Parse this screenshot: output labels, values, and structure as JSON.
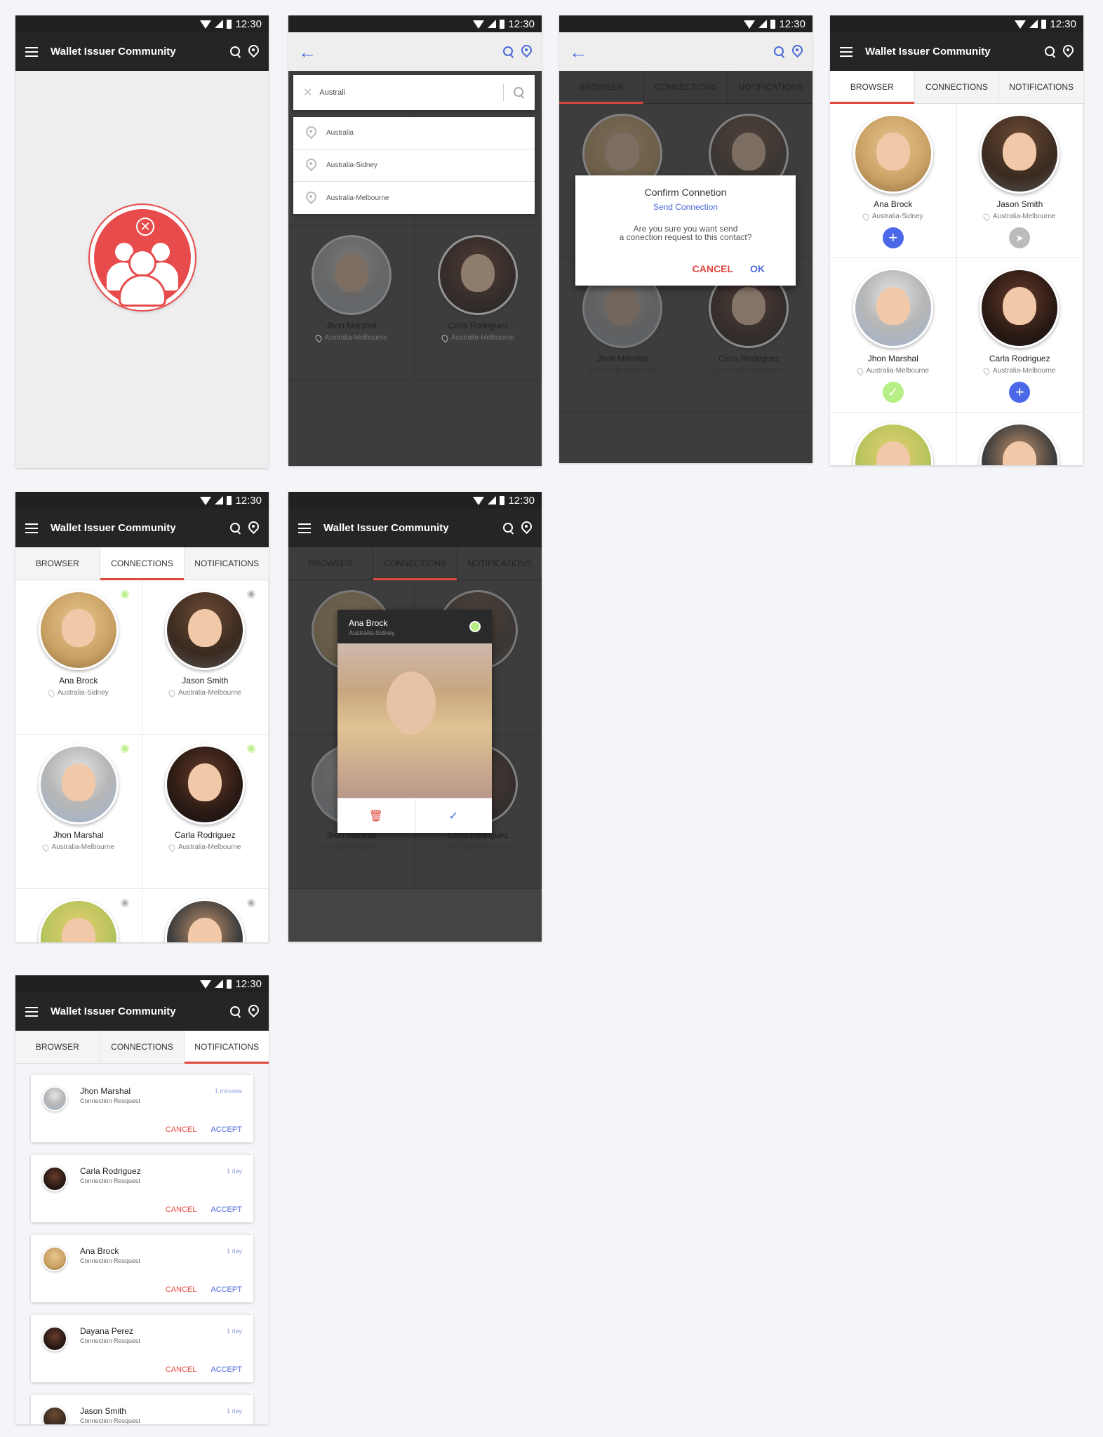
{
  "status": {
    "time": "12:30"
  },
  "app": {
    "title": "Wallet Issuer Community"
  },
  "tabs": {
    "browser": "BROWSER",
    "connections": "CONNECTIONS",
    "notifications": "NOTIFICATIONS"
  },
  "search": {
    "query": "Australi",
    "suggestions": [
      "Australia",
      "Australia-Sidney",
      "Australia-Melbourne"
    ]
  },
  "contacts": [
    {
      "name": "Ana Brock",
      "location": "Australia-Sidney"
    },
    {
      "name": "Jason Smith",
      "location": "Australia-Melbourne"
    },
    {
      "name": "Jhon Marshal",
      "location": "Australia-Melbourne"
    },
    {
      "name": "Carla Rodriguez",
      "location": "Australia-Melbourne"
    }
  ],
  "dialog": {
    "title": "Confirm Connetion",
    "subtitle": "Send Connection",
    "line1": "Are you sure you want send",
    "line2": "a conection request to this contact?",
    "cancel": "CANCEL",
    "ok": "OK"
  },
  "popup": {
    "name": "Ana Brock",
    "location": "Australia-Sidney"
  },
  "notifications": [
    {
      "name": "Jhon Marshal",
      "type": "Connection Resquest",
      "time": "1 minutes"
    },
    {
      "name": "Carla Rodriguez",
      "type": "Connection Resquest",
      "time": "1 day"
    },
    {
      "name": "Ana Brock",
      "type": "Connection Resquest",
      "time": "1 day"
    },
    {
      "name": "Dayana Perez",
      "type": "Connection Resquest",
      "time": "1 day"
    },
    {
      "name": "Jason Smith",
      "type": "Connection Resquest",
      "time": "1 day"
    }
  ],
  "notif_actions": {
    "cancel": "CANCEL",
    "accept": "ACCEPT"
  },
  "colors": {
    "accent": "#e0483e",
    "primary_blue": "#4a68d8",
    "online_green": "#b8ef82",
    "appbar": "#252525"
  }
}
